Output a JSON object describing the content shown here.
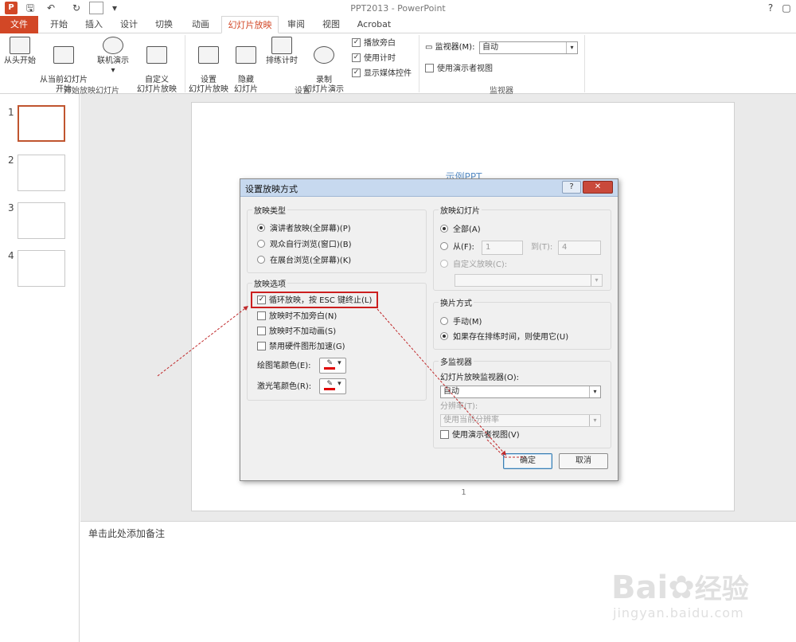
{
  "titlebar": {
    "title": "PPT2013 - PowerPoint",
    "help": "?",
    "qa_save": "🖫",
    "qa_undo": "↶",
    "qa_redo": "↻",
    "qa_more": "▾"
  },
  "tabs": [
    "文件",
    "开始",
    "插入",
    "设计",
    "切换",
    "动画",
    "幻灯片放映",
    "审阅",
    "视图",
    "Acrobat"
  ],
  "ribbon": {
    "from_start": "从头开始",
    "from_current": "从当前幻灯片\n开始",
    "online": "联机演示",
    "custom": "自定义\n幻灯片放映",
    "group_start": "开始放映幻灯片",
    "setup": "设置\n幻灯片放映",
    "hide": "隐藏\n幻灯片",
    "rehearse": "排练计时",
    "record": "录制\n幻灯片演示",
    "cb_narration": "播放旁白",
    "cb_timing": "使用计时",
    "cb_media": "显示媒体控件",
    "group_setup": "设置",
    "monitor_label": "监视器(M):",
    "monitor_value": "自动",
    "presenter_view": "使用演示者视图",
    "group_monitor": "监视器"
  },
  "slides": [
    "1",
    "2",
    "3",
    "4"
  ],
  "slide": {
    "title": "示例PPT",
    "page": "1"
  },
  "notes_placeholder": "单击此处添加备注",
  "dialog": {
    "title": "设置放映方式",
    "help": "?",
    "show_type": {
      "label": "放映类型",
      "options": [
        "演讲者放映(全屏幕)(P)",
        "观众自行浏览(窗口)(B)",
        "在展台浏览(全屏幕)(K)"
      ],
      "selected": 0
    },
    "show_options": {
      "label": "放映选项",
      "loop": "循环放映，按 ESC 键终止(L)",
      "no_narration": "放映时不加旁白(N)",
      "no_animation": "放映时不加动画(S)",
      "disable_hw": "禁用硬件图形加速(G)",
      "pen_color": "绘图笔颜色(E):",
      "laser_color": "激光笔颜色(R):"
    },
    "show_slides": {
      "label": "放映幻灯片",
      "all": "全部(A)",
      "from": "从(F):",
      "from_value": "1",
      "to": "到(T):",
      "to_value": "4",
      "custom": "自定义放映(C):"
    },
    "advance": {
      "label": "换片方式",
      "manual": "手动(M)",
      "timings": "如果存在排练时间，则使用它(U)"
    },
    "multi_monitor": {
      "label": "多监视器",
      "monitor_label": "幻灯片放映监视器(O):",
      "monitor_value": "自动",
      "resolution_label": "分辨率(T):",
      "resolution_value": "使用当前分辨率",
      "presenter_view": "使用演示者视图(V)"
    },
    "ok": "确定",
    "cancel": "取消"
  },
  "watermark": {
    "brand": "Bai",
    "brand_cn": "经验",
    "url": "jingyan.baidu.com"
  },
  "colors": {
    "accent": "#d24726",
    "highlight": "#cc1f1f",
    "pen": "#e00000"
  }
}
